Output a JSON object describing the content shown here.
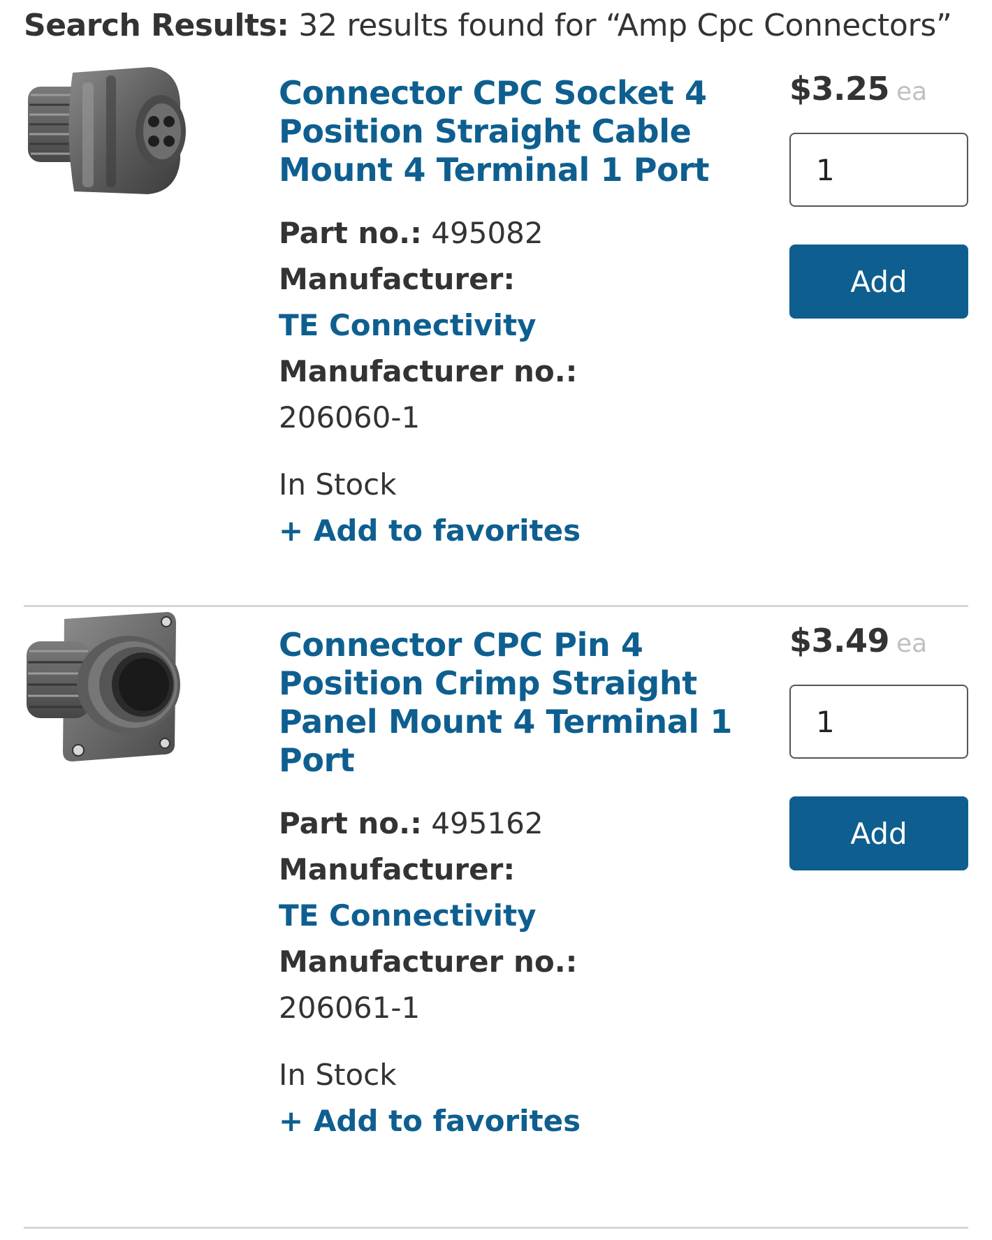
{
  "search": {
    "label": "Search Results:",
    "summary": "32 results found for “Amp Cpc Connectors”"
  },
  "colors": {
    "accent": "#0e5f8f",
    "text": "#333333",
    "muted": "#c0c0c0",
    "divider": "#d7d7d7"
  },
  "labels": {
    "part_no": "Part no.:",
    "manufacturer": "Manufacturer:",
    "manufacturer_no": "Manufacturer no.:",
    "add_button": "Add",
    "favorites": "+ Add to favorites"
  },
  "products": [
    {
      "image_icon": "cpc-socket-connector-image",
      "title": "Connector CPC Socket 4 Position Straight Cable Mount 4 Terminal 1 Port",
      "part_no": "495082",
      "manufacturer": "TE Connectivity",
      "manufacturer_no": "206060-1",
      "stock": "In Stock",
      "price": "$3.25",
      "unit": "ea",
      "quantity": "1"
    },
    {
      "image_icon": "cpc-pin-panel-connector-image",
      "title": "Connector CPC Pin 4 Position Crimp Straight Panel Mount 4 Terminal 1 Port",
      "part_no": "495162",
      "manufacturer": "TE Connectivity",
      "manufacturer_no": "206061-1",
      "stock": "In Stock",
      "price": "$3.49",
      "unit": "ea",
      "quantity": "1"
    }
  ]
}
